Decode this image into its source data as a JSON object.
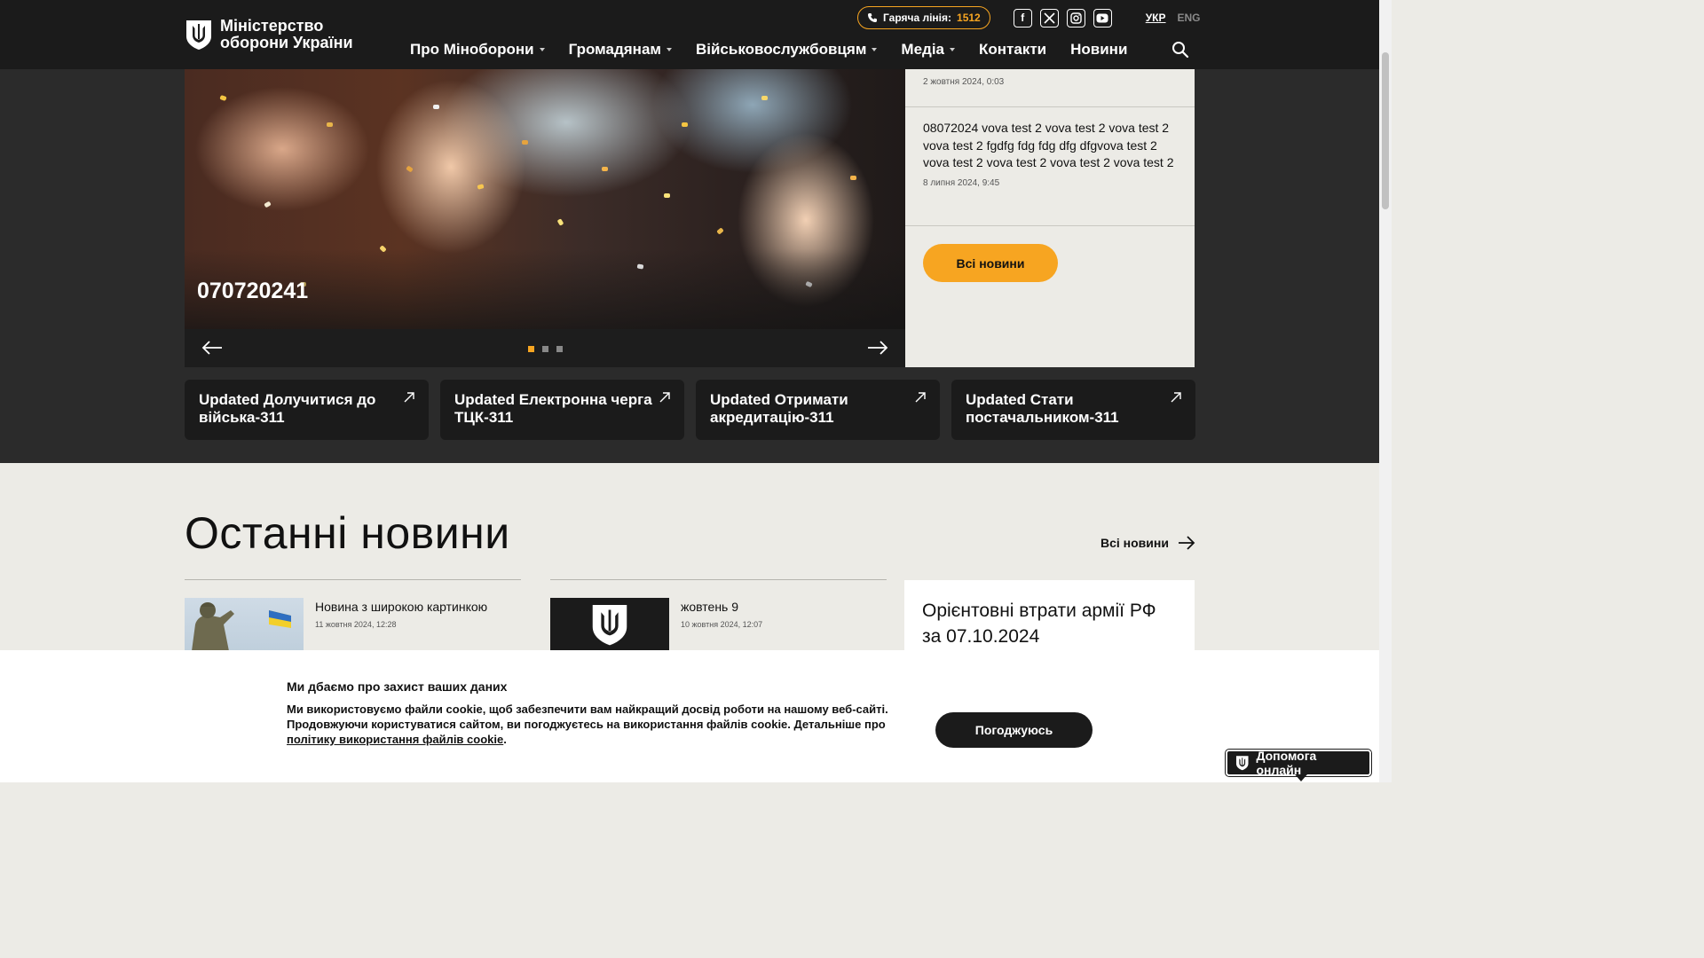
{
  "header": {
    "logo_text": "Міністерство оборони України",
    "hotline_label": "Гаряча лінія:",
    "hotline_number": "1512",
    "socials": [
      "facebook-icon",
      "x-icon",
      "instagram-icon",
      "youtube-icon"
    ],
    "lang_active": "УКР",
    "lang_other": "ENG",
    "nav": [
      "Про Міноборони",
      "Громадянам",
      "Військовослужбовцям",
      "Медіа",
      "Контакти",
      "Новини"
    ]
  },
  "hero": {
    "slide_caption": "070720241",
    "dots_total": 3,
    "dots_active": 1
  },
  "news_panel": {
    "item1_date": "2 жовтня 2024, 0:03",
    "item2_text": "08072024 vova test 2 vova test 2 vova test 2 vova test 2 fgdfg fdg fdg dfg dfgvova test 2 vova test 2 vova test 2 vova test 2 vova test 2",
    "item2_date": "8 липня 2024, 9:45",
    "all_news_button": "Всі новини"
  },
  "quick_links": [
    "Updated Долучитися до війська-311",
    "Updated Електронна черга ТЦК-311",
    "Updated Отримати акредитацію-311",
    "Updated Стати постачальником-311"
  ],
  "latest": {
    "title": "Останні новини",
    "all_news_link": "Всі новини",
    "items": [
      {
        "title": "Новина з широкою картинкою",
        "date": "11 жовтня 2024, 12:28"
      },
      {
        "title": "жовтень 9",
        "date": "10 жовтня 2024, 12:07"
      }
    ],
    "losses_title": "Орієнтовні втрати армії РФ за 07.10.2024"
  },
  "cookie": {
    "title": "Ми дбаємо про захист ваших даних",
    "text": "Ми використовуємо файли cookie, щоб забезпечити вам найкращий досвід роботи на нашому веб-сайті. Продовжуючи користуватися сайтом, ви погоджуєтесь на використання файлів cookie. Детальніше про ",
    "link": "політику використання файлів cookie",
    "text_end": ".",
    "agree_button": "Погоджуюсь"
  },
  "help": {
    "label": "Допомога онлайн"
  },
  "colors": {
    "accent": "#f7a521",
    "dark": "#1b1b1b",
    "light_bg": "#ecebe6"
  }
}
